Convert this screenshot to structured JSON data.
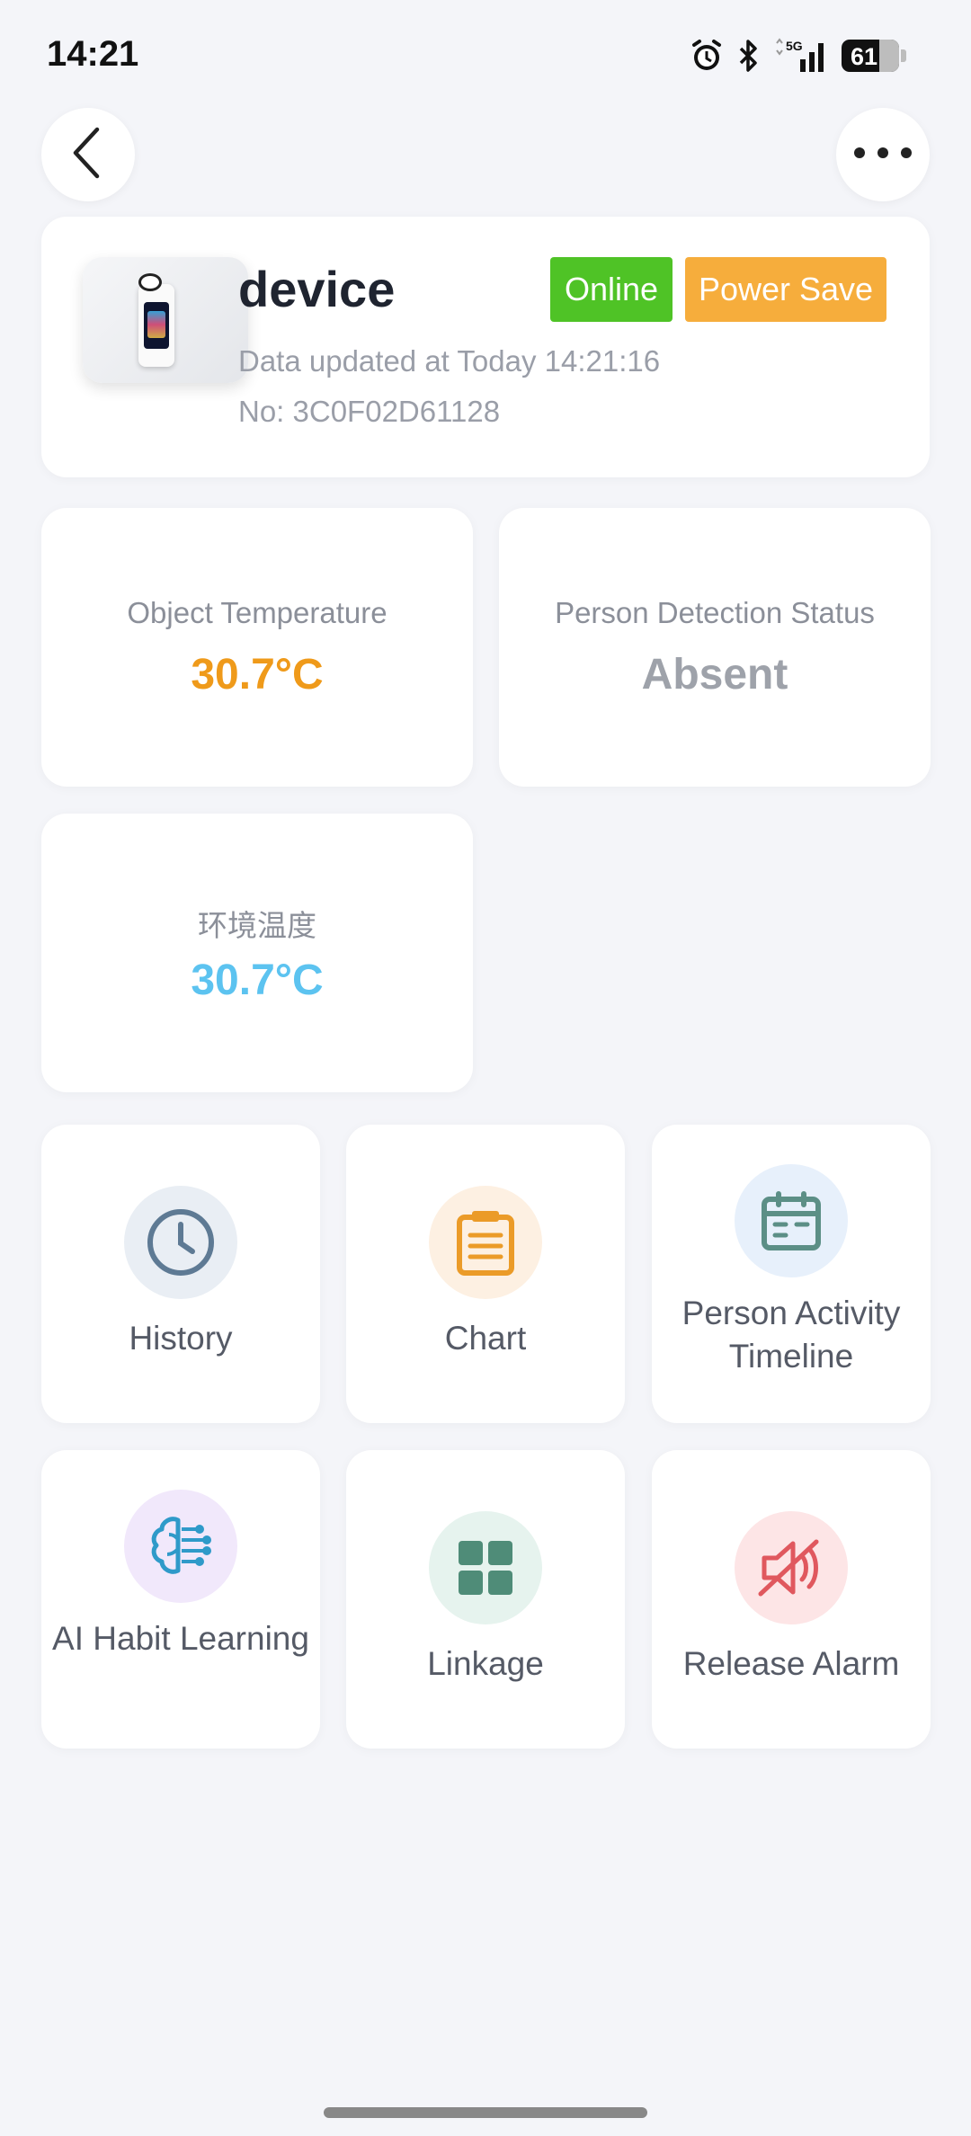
{
  "status_bar": {
    "time": "14:21",
    "battery": "61",
    "network": "5G"
  },
  "device": {
    "name": "device",
    "badges": {
      "online": "Online",
      "power_save": "Power Save"
    },
    "updated": "Data updated at Today 14:21:16",
    "number": "No: 3C0F02D61128"
  },
  "metrics": [
    {
      "label": "Object Temperature",
      "value": "30.7°C",
      "color": "#ef9a1a"
    },
    {
      "label": "Person Detection Status",
      "value": "Absent",
      "color": "#9ea2aa"
    },
    {
      "label": "环境温度",
      "value": "30.7°C",
      "color": "#5cc3f0"
    }
  ],
  "features": [
    {
      "label": "History",
      "icon": "clock-icon",
      "bg": "#e9eef4",
      "fg": "#5e7a94"
    },
    {
      "label": "Chart",
      "icon": "clipboard-list-icon",
      "bg": "#fdf0e2",
      "fg": "#eb9b28"
    },
    {
      "label": "Person Activity Timeline",
      "icon": "calendar-icon",
      "bg": "#e7f0fb",
      "fg": "#5c8f86"
    },
    {
      "label": "AI Habit Learning",
      "icon": "brain-circuit-icon",
      "bg": "#f1e8fb",
      "fg": "#2f9ac9"
    },
    {
      "label": "Linkage",
      "icon": "grid-icon",
      "bg": "#e6f3ee",
      "fg": "#4f8c78"
    },
    {
      "label": "Release Alarm",
      "icon": "mute-speaker-icon",
      "bg": "#fde5e6",
      "fg": "#e0585e"
    }
  ]
}
